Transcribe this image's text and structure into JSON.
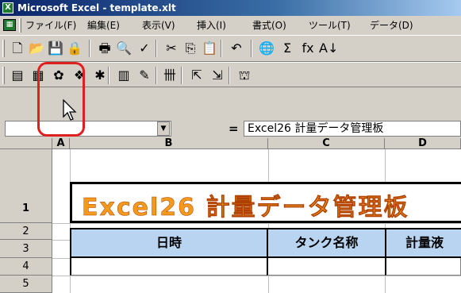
{
  "window": {
    "title": "Microsoft Excel - template.xlt"
  },
  "menu": [
    "ファイル(F)",
    "編集(E)",
    "表示(V)",
    "挿入(I)",
    "書式(O)",
    "ツール(T)",
    "データ(D)"
  ],
  "toolbar_standard": [
    {
      "name": "new-icon",
      "glyph": "🗋"
    },
    {
      "name": "open-icon",
      "glyph": "📂"
    },
    {
      "name": "save-icon",
      "glyph": "💾"
    },
    {
      "name": "permission-icon",
      "glyph": "🔒"
    },
    {
      "name": "print-icon",
      "glyph": "🖶"
    },
    {
      "name": "print-preview-icon",
      "glyph": "🔍"
    },
    {
      "name": "spelling-icon",
      "glyph": "✓"
    },
    {
      "name": "cut-icon",
      "glyph": "✂"
    },
    {
      "name": "copy-icon",
      "glyph": "⎘"
    },
    {
      "name": "paste-icon",
      "glyph": "📋"
    },
    {
      "name": "undo-icon",
      "glyph": "↶"
    },
    {
      "name": "hyperlink-icon",
      "glyph": "🌐"
    },
    {
      "name": "autosum-icon",
      "glyph": "Σ"
    },
    {
      "name": "function-icon",
      "glyph": "fx"
    },
    {
      "name": "sort-ascending-icon",
      "glyph": "A↓"
    }
  ],
  "toolbar_custom": [
    {
      "name": "custom-tool-1-icon",
      "glyph": "▤"
    },
    {
      "name": "data-form-icon",
      "glyph": "▦"
    },
    {
      "name": "custom-tool-3-icon",
      "glyph": "✿"
    },
    {
      "name": "custom-tool-4-icon",
      "glyph": "❖"
    },
    {
      "name": "custom-tool-5-icon",
      "glyph": "✱"
    },
    {
      "name": "custom-tool-6-icon",
      "glyph": "▥"
    },
    {
      "name": "custom-tool-7-icon",
      "glyph": "✎"
    },
    {
      "name": "custom-tool-8-icon",
      "glyph": "卌"
    },
    {
      "name": "custom-tool-9-icon",
      "glyph": "⇱"
    },
    {
      "name": "custom-tool-10-icon",
      "glyph": "⇲"
    },
    {
      "name": "custom-tool-11-icon",
      "glyph": "⛫"
    }
  ],
  "formula_bar": {
    "name_box": "",
    "equals": "=",
    "content": "Excel26 計量データ管理板"
  },
  "columns": [
    "A",
    "B",
    "C",
    "D"
  ],
  "rows": [
    "1",
    "2",
    "3",
    "4",
    "5"
  ],
  "sheet": {
    "title": "Excel26 計量データ管理板",
    "header_cells": [
      "日時",
      "タンク名称",
      "計量液"
    ]
  },
  "colors": {
    "title_bar": "#0a246a",
    "title_text": "#f39a1e",
    "header_fill": "#b8d4f0",
    "highlight_ring": "#e02020"
  }
}
